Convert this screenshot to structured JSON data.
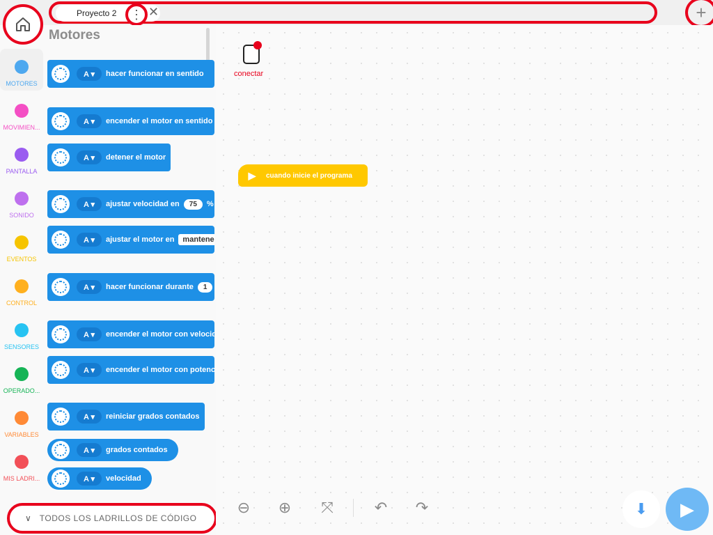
{
  "topbar": {
    "tab_label": "Proyecto 2",
    "tab_menu_glyph": "⋮",
    "tab_close_glyph": "✕",
    "add_tab_glyph": "+"
  },
  "categories": [
    {
      "label": "MOTORES",
      "color": "#4ea8ef"
    },
    {
      "label": "MOVIMIEN...",
      "color": "#f44fc4"
    },
    {
      "label": "PANTALLA",
      "color": "#9a5cf0"
    },
    {
      "label": "SONIDO",
      "color": "#be70ee"
    },
    {
      "label": "EVENTOS",
      "color": "#f6c400"
    },
    {
      "label": "CONTROL",
      "color": "#ffb01f"
    },
    {
      "label": "SENSORES",
      "color": "#27c3f2"
    },
    {
      "label": "OPERADO...",
      "color": "#16b456"
    },
    {
      "label": "VARIABLES",
      "color": "#ff8a36"
    },
    {
      "label": "MIS LADRI...",
      "color": "#f25058"
    }
  ],
  "palette": {
    "title": "Motores",
    "footer_label": "TODOS LOS LADRILLOS DE CÓDIGO",
    "footer_chevron": "∨",
    "blocks": [
      {
        "port": "A ▾",
        "text": "hacer funcionar  en sentido"
      },
      {
        "port": "A ▾",
        "text": "encender el motor  en sentido"
      },
      {
        "port": "A ▾",
        "text": "detener el motor"
      },
      {
        "port": "A ▾",
        "text": "ajustar velocidad en",
        "value": "75",
        "suffix": "%"
      },
      {
        "port": "A ▾",
        "text": "ajustar el motor en",
        "dropdown": "mantene"
      },
      {
        "port": "A ▾",
        "text": "hacer funcionar durante",
        "value": "1"
      },
      {
        "port": "A ▾",
        "text": "encender el motor con velocid"
      },
      {
        "port": "A ▾",
        "text": "encender el motor con potenc"
      },
      {
        "port": "A ▾",
        "text": "reiniciar grados contados"
      },
      {
        "port": "A ▾",
        "text": "grados contados"
      },
      {
        "port": "A ▾",
        "text": "velocidad"
      }
    ]
  },
  "canvas": {
    "hub_label": "conectar",
    "event_label": "cuando inicie el programa",
    "play_glyph": "▶"
  },
  "toolbar": {
    "zoom_out": "⊖",
    "zoom_in": "⊕",
    "recenter": "⤧",
    "undo": "↶",
    "redo": "↷",
    "download": "⬇",
    "run": "▶"
  }
}
